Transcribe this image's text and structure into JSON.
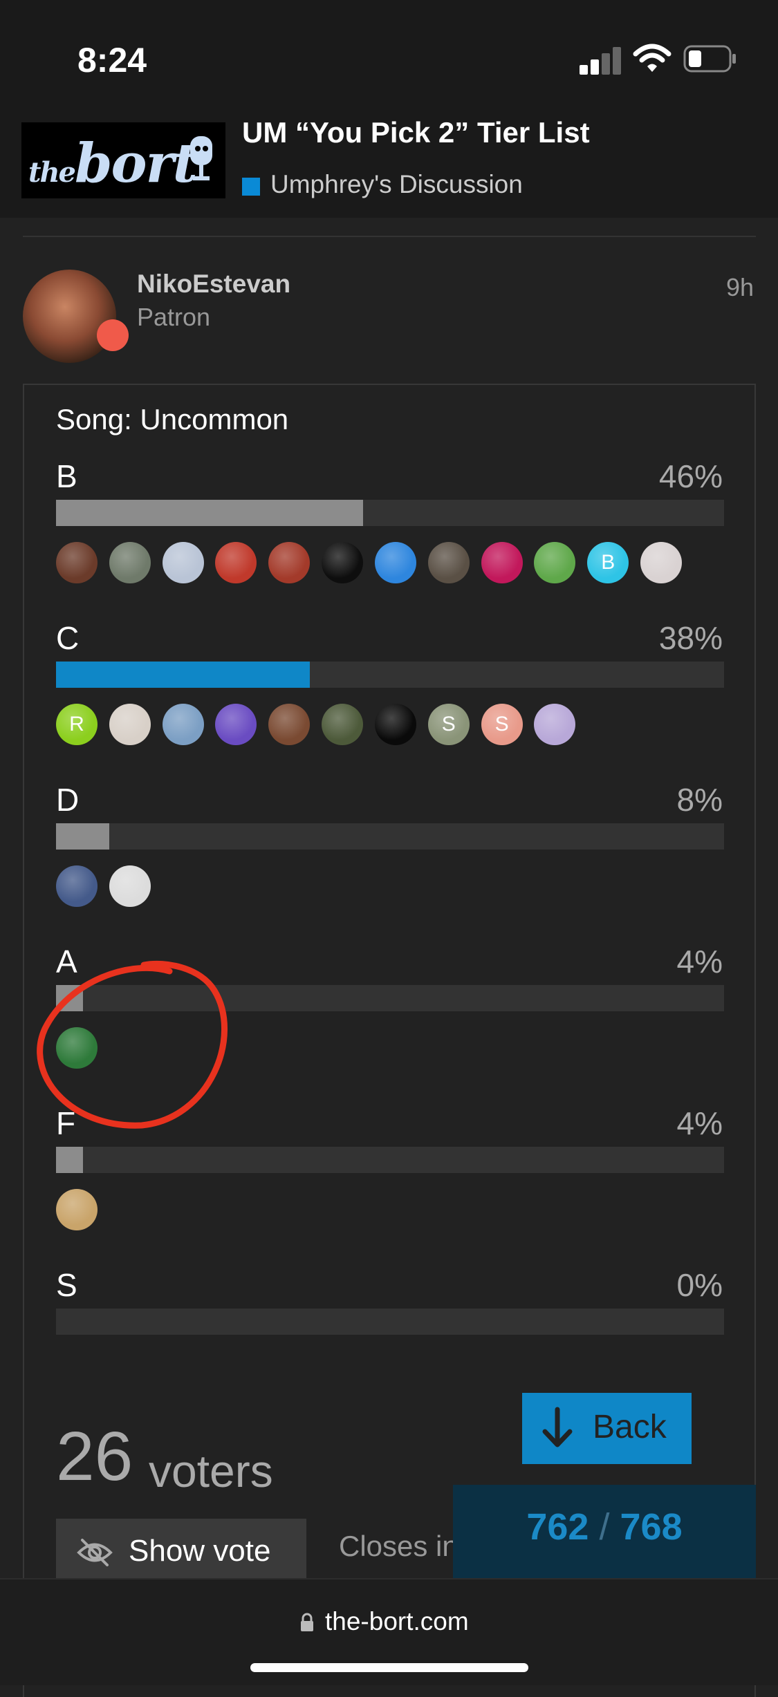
{
  "status_bar": {
    "time": "8:24"
  },
  "header": {
    "logo_text_prefix": "the",
    "logo_text_main": "bort",
    "topic_title": "UM “You Pick 2” Tier List",
    "category": "Umphrey's Discussion",
    "category_color": "#0a8ad6"
  },
  "post": {
    "username": "NikoEstevan",
    "user_title": "Patron",
    "age": "9h"
  },
  "poll": {
    "heading": "Song: Uncommon",
    "options": [
      {
        "label": "B",
        "percent_text": "46%",
        "percent": 46,
        "chosen": false,
        "voters": [
          {
            "color": "#6b3b2a"
          },
          {
            "color": "#6f7a6a"
          },
          {
            "color": "#b9c4d6"
          },
          {
            "color": "#c0392b"
          },
          {
            "color": "#a33a2a"
          },
          {
            "color": "#0e0e0e"
          },
          {
            "color": "#2e86de"
          },
          {
            "color": "#5a5045"
          },
          {
            "color": "#c2185b"
          },
          {
            "color": "#5fa84a"
          },
          {
            "color": "#2ec4e6",
            "initial": "B"
          },
          {
            "color": "#d9d2d2"
          }
        ]
      },
      {
        "label": "C",
        "percent_text": "38%",
        "percent": 38,
        "chosen": true,
        "voters": [
          {
            "color": "#8ccf1e",
            "initial": "R"
          },
          {
            "color": "#d8d0c8"
          },
          {
            "color": "#7c9fc4"
          },
          {
            "color": "#6a4cc2"
          },
          {
            "color": "#7a4a32"
          },
          {
            "color": "#4d5a3a"
          },
          {
            "color": "#0a0a0a"
          },
          {
            "color": "#8a9478",
            "initial": "S"
          },
          {
            "color": "#e89a8a",
            "initial": "S"
          },
          {
            "color": "#b8a8d8"
          }
        ]
      },
      {
        "label": "D",
        "percent_text": "8%",
        "percent": 8,
        "chosen": false,
        "voters": [
          {
            "color": "#445a8a"
          },
          {
            "color": "#dcdcdc"
          }
        ]
      },
      {
        "label": "A",
        "percent_text": "4%",
        "percent": 4,
        "chosen": false,
        "voters": [
          {
            "color": "#2e7a3a"
          }
        ]
      },
      {
        "label": "F",
        "percent_text": "4%",
        "percent": 4,
        "chosen": false,
        "voters": [
          {
            "color": "#c9a46a"
          }
        ]
      },
      {
        "label": "S",
        "percent_text": "0%",
        "percent": 0,
        "chosen": false,
        "voters": []
      }
    ],
    "voter_count": "26",
    "voters_label": "voters",
    "show_vote_label": "Show vote",
    "closes_text": "Closes in"
  },
  "navigation": {
    "back_label": "Back",
    "progress_current": "762",
    "progress_separator": "/",
    "progress_total": "768"
  },
  "browser": {
    "url": "the-bort.com"
  },
  "colors": {
    "accent": "#0f87c7",
    "annotation_stroke": "#e8321e",
    "status_dot": "#f05a4a"
  }
}
